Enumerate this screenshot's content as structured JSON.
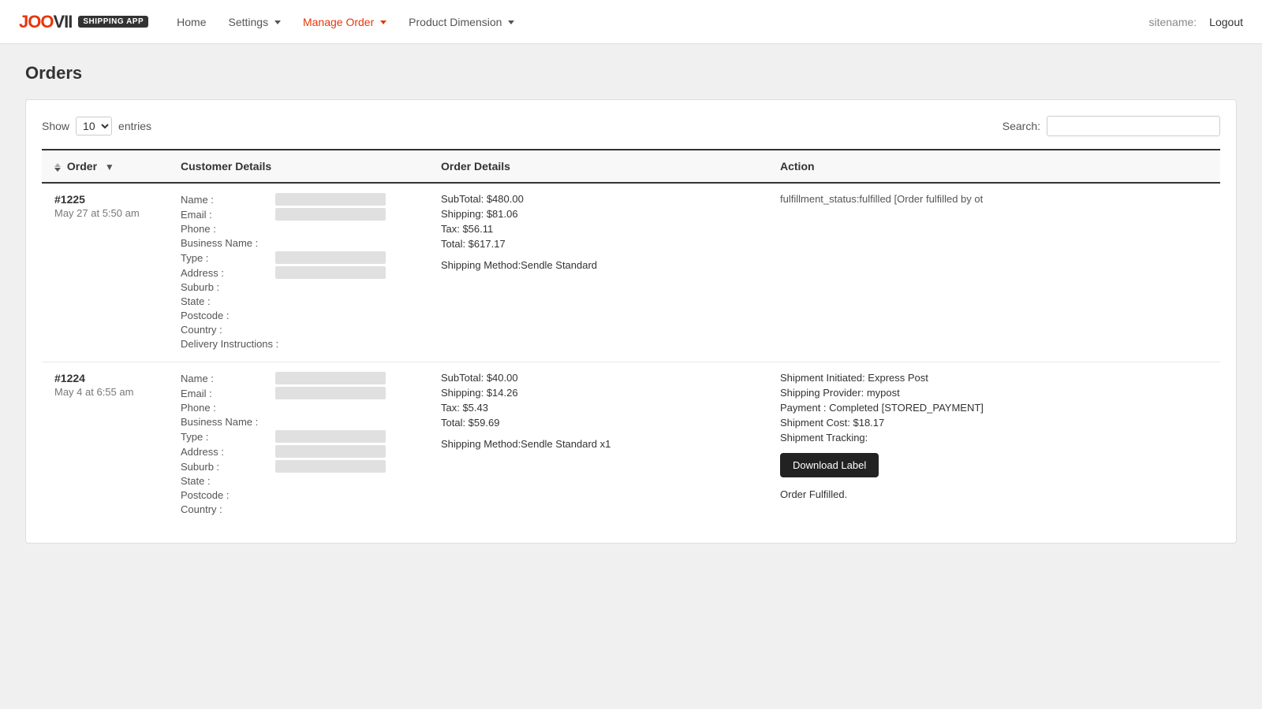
{
  "brand": {
    "logo": "JOOVII",
    "logo_accent": "JOO",
    "logo_dark": "VII",
    "badge": "SHIPPING APP"
  },
  "navbar": {
    "home": "Home",
    "settings": "Settings",
    "manage_order": "Manage Order",
    "product_dimension": "Product Dimension",
    "sitename_label": "sitename:",
    "logout": "Logout"
  },
  "page": {
    "title": "Orders"
  },
  "table_controls": {
    "show_label": "Show",
    "entries_label": "entries",
    "entries_value": "10",
    "search_label": "Search:"
  },
  "table": {
    "headers": {
      "order": "Order",
      "customer_details": "Customer Details",
      "order_details": "Order Details",
      "action": "Action"
    },
    "rows": [
      {
        "order_num": "#1225",
        "order_date": "May 27 at 5:50 am",
        "customer_fields": [
          {
            "label": "Name :",
            "has_value": true
          },
          {
            "label": "Email :",
            "has_value": true
          },
          {
            "label": "Phone :",
            "has_value": false
          },
          {
            "label": "Business Name :",
            "has_value": false
          },
          {
            "label": "Type :",
            "has_value": true
          },
          {
            "label": "Address :",
            "has_value": true
          },
          {
            "label": "Suburb :",
            "has_value": false
          },
          {
            "label": "State :",
            "has_value": false
          },
          {
            "label": "Postcode :",
            "has_value": false
          },
          {
            "label": "Country :",
            "has_value": false
          },
          {
            "label": "Delivery Instructions :",
            "has_value": false
          }
        ],
        "order_details": {
          "subtotal": "SubTotal: $480.00",
          "shipping": "Shipping: $81.06",
          "tax": "Tax: $56.11",
          "total": "Total: $617.17",
          "shipping_method": "Shipping Method:Sendle Standard"
        },
        "action": {
          "type": "fulfilled",
          "text": "fulfillment_status:fulfilled [Order fulfilled by ot"
        }
      },
      {
        "order_num": "#1224",
        "order_date": "May 4 at 6:55 am",
        "customer_fields": [
          {
            "label": "Name :",
            "has_value": true
          },
          {
            "label": "Email :",
            "has_value": true
          },
          {
            "label": "Phone :",
            "has_value": false
          },
          {
            "label": "Business Name :",
            "has_value": false
          },
          {
            "label": "Type :",
            "has_value": true
          },
          {
            "label": "Address :",
            "has_value": true
          },
          {
            "label": "Suburb :",
            "has_value": true
          },
          {
            "label": "State :",
            "has_value": false
          },
          {
            "label": "Postcode :",
            "has_value": false
          },
          {
            "label": "Country :",
            "has_value": false
          }
        ],
        "order_details": {
          "subtotal": "SubTotal: $40.00",
          "shipping": "Shipping: $14.26",
          "tax": "Tax: $5.43",
          "total": "Total: $59.69",
          "shipping_method": "Shipping Method:Sendle Standard x1"
        },
        "action": {
          "type": "initiated",
          "shipment_initiated": "Shipment Initiated: Express Post",
          "provider": "Shipping Provider: mypost",
          "payment": "Payment : Completed [STORED_PAYMENT]",
          "cost": "Shipment Cost: $18.17",
          "tracking": "Shipment Tracking:",
          "download_label": "Download Label",
          "order_fulfilled": "Order Fulfilled."
        }
      }
    ]
  }
}
